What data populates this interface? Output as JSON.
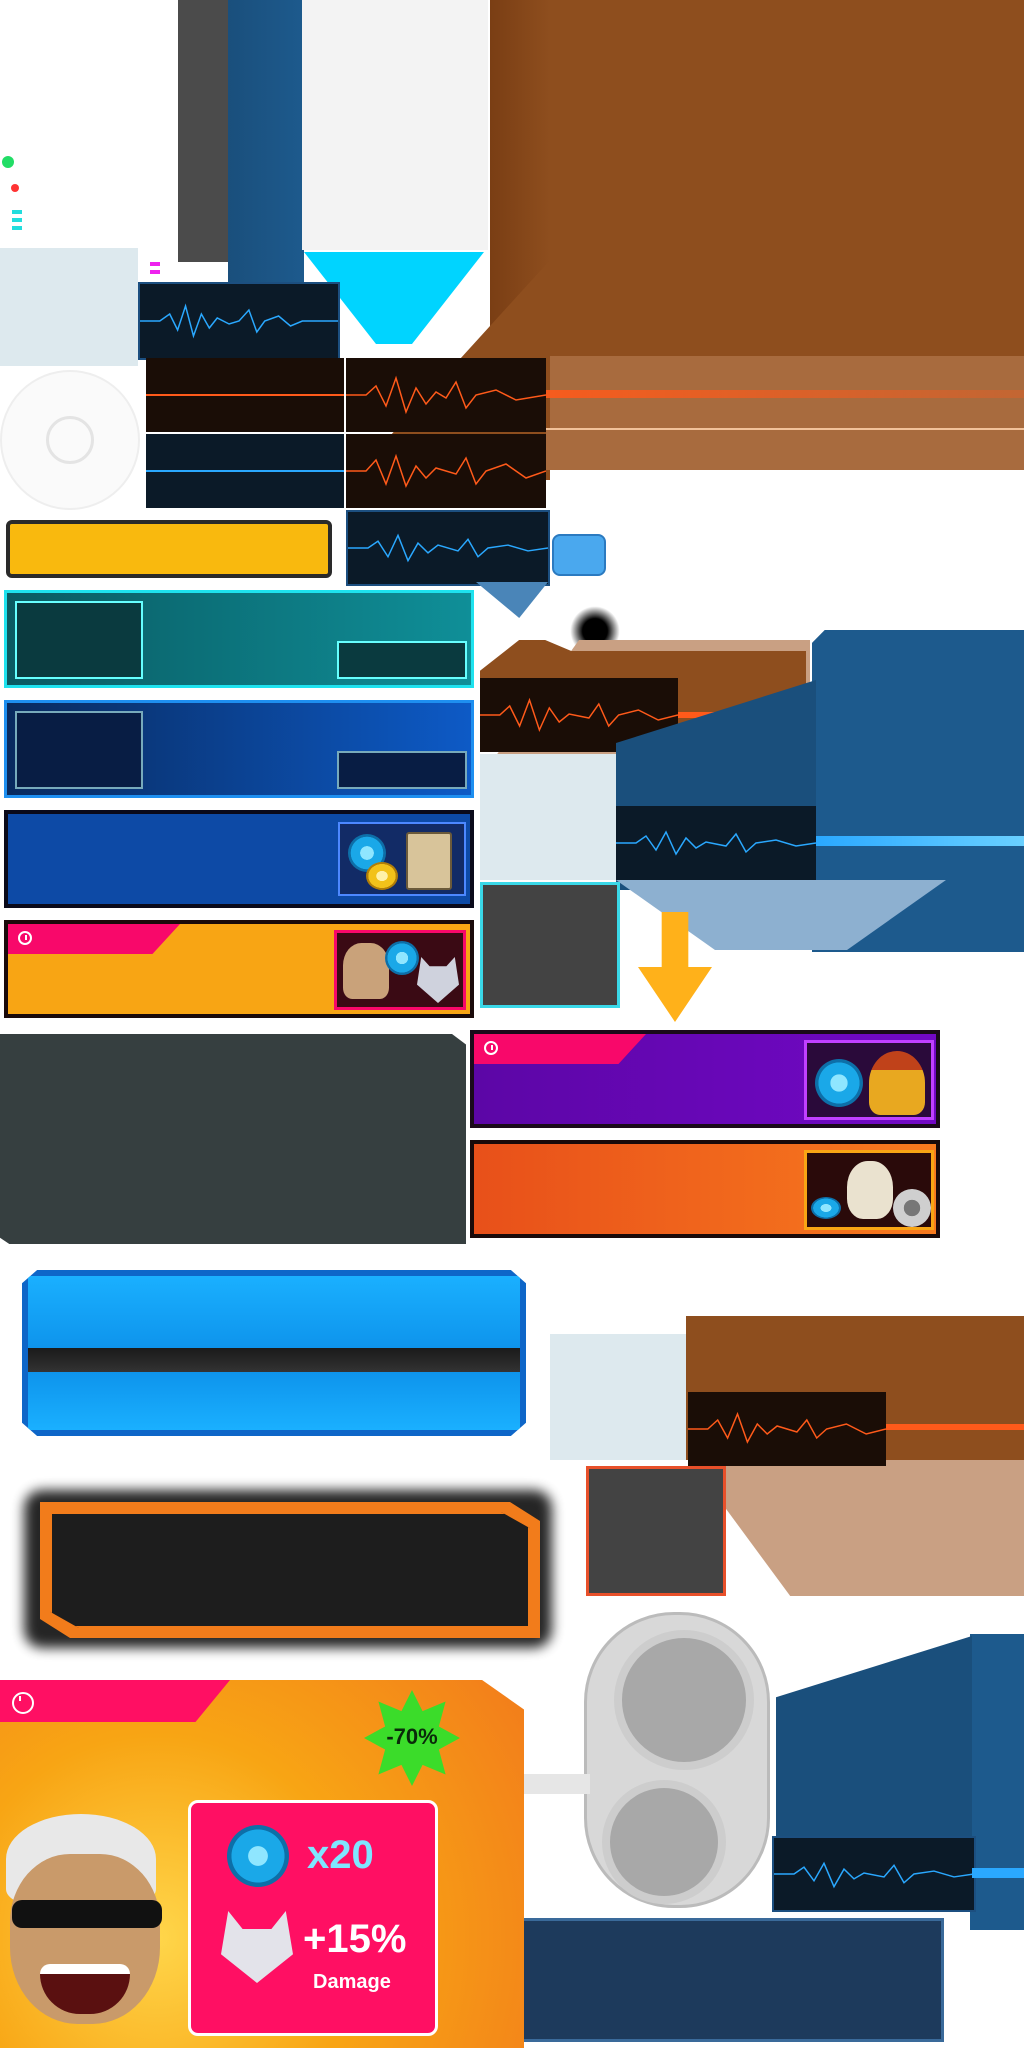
{
  "colors": {
    "brown": "#8e4e1e",
    "brown_light": "#c9a083",
    "navy": "#1d5a8d",
    "cyan": "#00d4ff",
    "yellow": "#f9b90e",
    "teal": "#0f7f86",
    "royal_blue": "#0d4aa6",
    "orange": "#f86a17",
    "purple": "#6a06b8",
    "pink": "#f8086a",
    "dark_slate": "#363f40",
    "promo_orange": "#f8a514",
    "promo_pink": "#ff0f63",
    "burst_green": "#3bdc2a",
    "button_blue": "#0ea2f2",
    "button_orange": "#f27c1b"
  },
  "icons": {
    "coin": "blue-coin-icon",
    "gold_coin": "gold-coin-icon",
    "demon_mask": "demon-mask-icon",
    "clock": "clock-icon",
    "arrow": "down-arrow-icon"
  },
  "promo": {
    "discount": "-70%",
    "coin_amount": "x20",
    "bonus_value": "+15%",
    "bonus_label": "Damage"
  }
}
